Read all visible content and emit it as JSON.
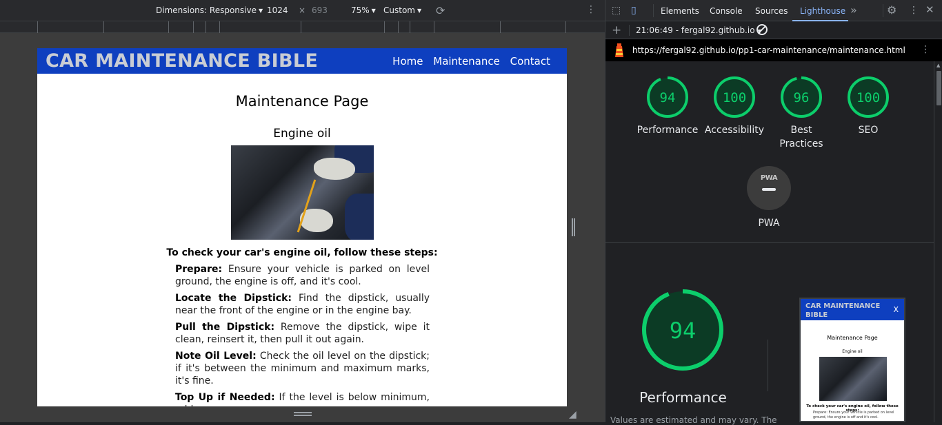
{
  "device_toolbar": {
    "dimensions_label": "Dimensions: Responsive",
    "width": "1024",
    "times": "×",
    "height": "693",
    "zoom": "75%",
    "throttle": "Custom"
  },
  "site": {
    "title": "CAR MAINTENANCE BIBLE",
    "nav": [
      "Home",
      "Maintenance",
      "Contact"
    ],
    "page_title": "Maintenance Page",
    "section_title": "Engine oil",
    "steps_intro": "To check your car's engine oil, follow these steps:",
    "steps": [
      {
        "label": "Prepare:",
        "text": " Ensure your vehicle is parked on level ground, the engine is off, and it's cool."
      },
      {
        "label": "Locate the Dipstick:",
        "text": " Find the dipstick, usually near the front of the engine or in the engine bay."
      },
      {
        "label": "Pull the Dipstick:",
        "text": " Remove the dipstick, wipe it clean, reinsert it, then pull it out again."
      },
      {
        "label": "Note Oil Level:",
        "text": " Check the oil level on the dipstick; if it's between the minimum and maximum marks, it's fine."
      },
      {
        "label": "Top Up if Needed:",
        "text": " If the level is below minimum, add"
      }
    ]
  },
  "devtools": {
    "tabs": [
      "Elements",
      "Console",
      "Sources",
      "Lighthouse"
    ],
    "active_tab": "Lighthouse",
    "report_label": "21:06:49 - fergal92.github.io",
    "url": "https://fergal92.github.io/pp1-car-maintenance/maintenance.html",
    "scores": [
      {
        "label": "Performance",
        "value": 94
      },
      {
        "label": "Accessibility",
        "value": 100
      },
      {
        "label": "Best Practices",
        "value": 96
      },
      {
        "label": "SEO",
        "value": 100
      }
    ],
    "pwa_badge": "PWA",
    "pwa_label": "PWA",
    "performance": {
      "score": 94,
      "title": "Performance",
      "note": "Values are estimated and may vary. The"
    },
    "colors": {
      "pass_green": "#0cce6b",
      "pass_fill": "#0c3b25",
      "accent_blue": "#8ab4f8",
      "site_header_blue": "#0e3fbf"
    }
  },
  "thumbnail": {
    "title": "CAR MAINTENANCE BIBLE",
    "close": "X",
    "page_title": "Maintenance Page",
    "section_title": "Engine oil",
    "intro": "To check your car's engine oil, follow these steps:",
    "step": "Prepare: Ensure your vehicle is parked on level ground, the engine is off and it's cool."
  }
}
